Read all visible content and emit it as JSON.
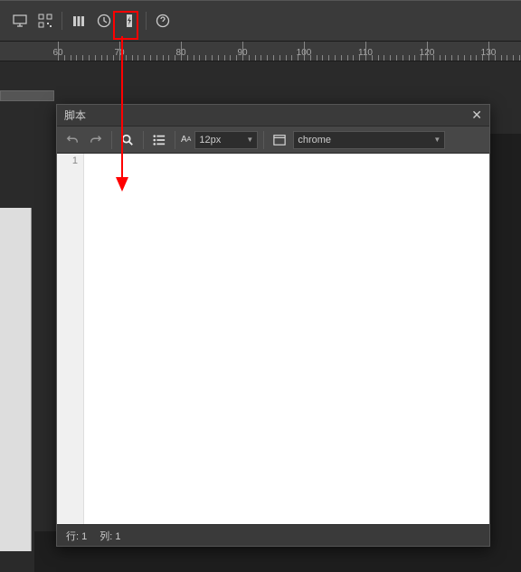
{
  "ruler": {
    "ticks": [
      60,
      70,
      80,
      90,
      100,
      110,
      120,
      130
    ],
    "spacing": 68,
    "offset": 64
  },
  "panel": {
    "title": "脚本",
    "fontSizeLabel": "12px",
    "browserLabel": "chrome",
    "lineNumbers": [
      "1"
    ],
    "footer": {
      "row_label": "行:",
      "row_val": "1",
      "col_label": "列:",
      "col_val": "1"
    }
  },
  "annotation": {
    "color": "red"
  }
}
